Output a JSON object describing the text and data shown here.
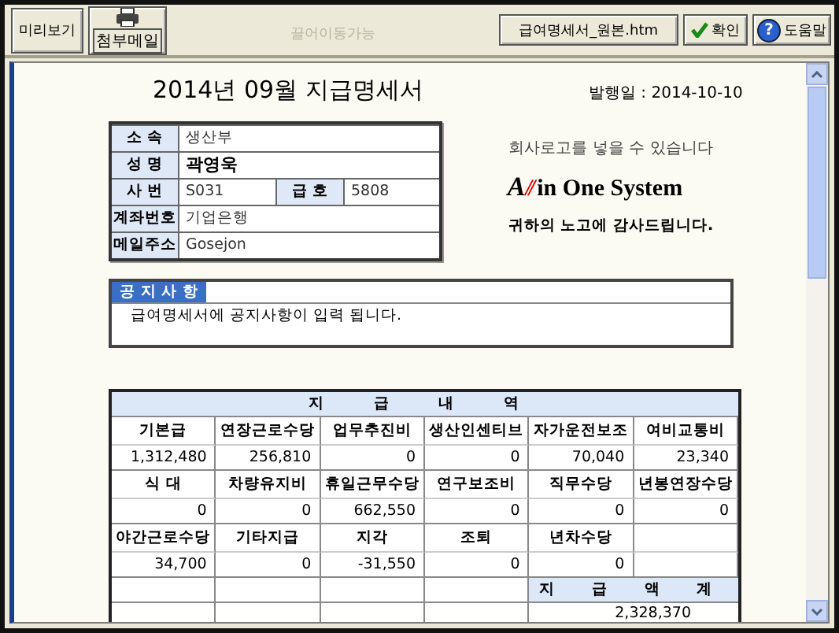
{
  "toolbar": {
    "buttons": [
      {
        "kind": "text",
        "label": "미리보기"
      },
      {
        "kind": "printer",
        "label": "첨부메일"
      }
    ],
    "drag_hint": "끌어이동가능",
    "actions": [
      {
        "kind": "file",
        "label": "급여명세서_원본.htm"
      },
      {
        "kind": "check",
        "label": "확인"
      },
      {
        "kind": "help",
        "icon": "?",
        "label": "도움말"
      }
    ]
  },
  "document": {
    "title": "2014년 09월 지급명세서",
    "issue_date": "발행일 : 2014-10-10",
    "info": [
      [
        {
          "label": "소 속",
          "value": "생산부"
        }
      ],
      [
        {
          "label": "성 명",
          "value": "곽영욱",
          "bold": true
        }
      ],
      [
        {
          "label": "사 번",
          "value": "S031"
        },
        {
          "label": "급 호",
          "value": "5808"
        }
      ],
      [
        {
          "label": "계좌번호",
          "value": "기업은행"
        }
      ],
      [
        {
          "label": "메일주소",
          "value": "Gosejon"
        }
      ]
    ],
    "logo": {
      "hint": "회사로고를 넣을 수 있습니다",
      "lead": "A",
      "mark": "//",
      "rest": "in One System",
      "thanks": "귀하의 노고에 감사드립니다."
    },
    "notice": {
      "title": "공 지 사 항",
      "text": "급여명세서에 공지사항이 입력 됩니다."
    },
    "payments": {
      "title": "지 급 내 역",
      "rows": [
        [
          {
            "label": "기본급",
            "value": "1,312,480"
          },
          {
            "label": "연장근로수당",
            "value": "256,810"
          },
          {
            "label": "업무추진비",
            "value": "0"
          },
          {
            "label": "생산인센티브",
            "value": "0"
          },
          {
            "label": "자가운전보조",
            "value": "70,040"
          },
          {
            "label": "여비교통비",
            "value": "23,340"
          }
        ],
        [
          {
            "label": "식 대",
            "value": "0"
          },
          {
            "label": "차량유지비",
            "value": "0"
          },
          {
            "label": "휴일근무수당",
            "value": "662,550"
          },
          {
            "label": "연구보조비",
            "value": "0"
          },
          {
            "label": "직무수당",
            "value": "0"
          },
          {
            "label": "년봉연장수당",
            "value": "0"
          }
        ],
        [
          {
            "label": "야간근로수당",
            "value": "34,700"
          },
          {
            "label": "기타지급",
            "value": "0"
          },
          {
            "label": "지각",
            "value": "-31,550"
          },
          {
            "label": "조퇴",
            "value": "0"
          },
          {
            "label": "년차수당",
            "value": "0"
          }
        ]
      ],
      "total": {
        "label": "지 급 액 계",
        "value": "2,328,370"
      }
    }
  }
}
